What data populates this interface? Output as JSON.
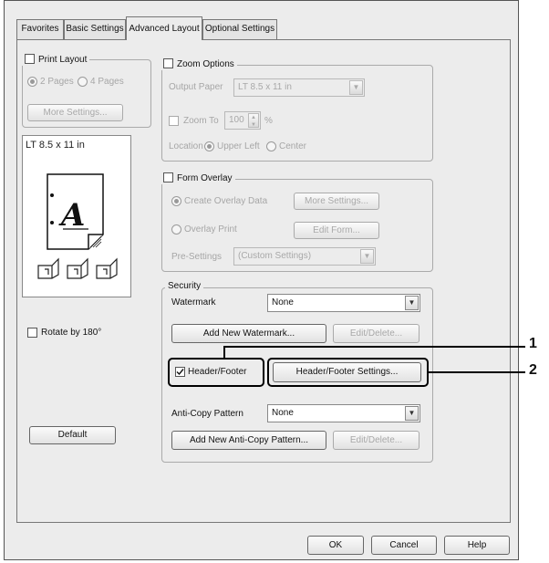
{
  "tabs": [
    "Favorites",
    "Basic Settings",
    "Advanced Layout",
    "Optional Settings"
  ],
  "print_layout": {
    "label": "Print Layout",
    "radio_2pages": "2 Pages",
    "radio_4pages": "4 Pages",
    "more_settings": "More Settings...",
    "preview_label": "LT 8.5 x 11 in",
    "preview_letter": "A",
    "rotate_label": "Rotate by 180°",
    "default_button": "Default"
  },
  "zoom": {
    "label": "Zoom Options",
    "output_paper_label": "Output Paper",
    "output_paper_value": "LT 8.5 x 11 in",
    "zoom_to_label": "Zoom To",
    "zoom_value": "100",
    "percent": "%",
    "location_label": "Location",
    "upper_left": "Upper Left",
    "center": "Center"
  },
  "form_overlay": {
    "label": "Form Overlay",
    "create_overlay": "Create Overlay Data",
    "more_settings": "More Settings...",
    "overlay_print": "Overlay Print",
    "edit_form": "Edit Form...",
    "presettings_label": "Pre-Settings",
    "presettings_value": "(Custom Settings)"
  },
  "security": {
    "label": "Security",
    "watermark_label": "Watermark",
    "watermark_value": "None",
    "add_watermark": "Add New Watermark...",
    "edit_delete_1": "Edit/Delete...",
    "header_footer": "Header/Footer",
    "header_footer_checked": true,
    "header_footer_settings": "Header/Footer Settings...",
    "anticopy_label": "Anti-Copy Pattern",
    "anticopy_value": "None",
    "add_anticopy": "Add New Anti-Copy Pattern...",
    "edit_delete_2": "Edit/Delete..."
  },
  "footer_buttons": {
    "ok": "OK",
    "cancel": "Cancel",
    "help": "Help"
  },
  "callouts": {
    "one": "1",
    "two": "2"
  }
}
